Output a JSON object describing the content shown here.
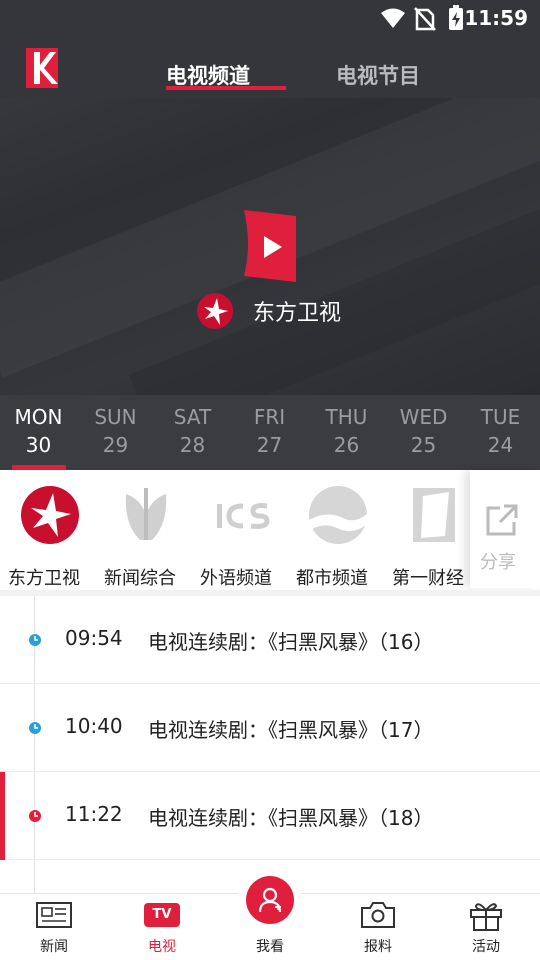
{
  "status_bar": {
    "time": "11:59"
  },
  "header": {
    "tabs": [
      {
        "label": "电视频道",
        "active": true
      },
      {
        "label": "电视节目",
        "active": false
      }
    ]
  },
  "player": {
    "channel_name": "东方卫视"
  },
  "dates": [
    {
      "dow": "MON",
      "num": "30",
      "active": true
    },
    {
      "dow": "SUN",
      "num": "29",
      "active": false
    },
    {
      "dow": "SAT",
      "num": "28",
      "active": false
    },
    {
      "dow": "FRI",
      "num": "27",
      "active": false
    },
    {
      "dow": "THU",
      "num": "26",
      "active": false
    },
    {
      "dow": "WED",
      "num": "25",
      "active": false
    },
    {
      "dow": "TUE",
      "num": "24",
      "active": false
    }
  ],
  "channels": [
    {
      "label": "东方卫视",
      "icon": "dragon-tv-icon"
    },
    {
      "label": "新闻综合",
      "icon": "news-channel-icon"
    },
    {
      "label": "外语频道",
      "icon": "ics-icon"
    },
    {
      "label": "都市频道",
      "icon": "city-channel-icon"
    },
    {
      "label": "第一财经",
      "icon": "finance-channel-icon"
    }
  ],
  "share": {
    "label": "分享",
    "icon": "share-icon"
  },
  "schedule": [
    {
      "time": "09:54",
      "title": "电视连续剧：《扫黑风暴》（16）",
      "live": false
    },
    {
      "time": "10:40",
      "title": "电视连续剧：《扫黑风暴》（17）",
      "live": false
    },
    {
      "time": "11:22",
      "title": "电视连续剧：《扫黑风暴》（18）",
      "live": true
    }
  ],
  "bottom_nav": [
    {
      "label": "新闻",
      "icon": "newspaper-icon"
    },
    {
      "label": "电视",
      "icon": "tv-icon",
      "badge": "TV",
      "active": true
    },
    {
      "label": "我看",
      "icon": "user-icon"
    },
    {
      "label": "报料",
      "icon": "camera-icon"
    },
    {
      "label": "活动",
      "icon": "gift-icon"
    }
  ],
  "colors": {
    "accent": "#e01f3d",
    "header_bg": "#34363b",
    "datebar_bg": "#3a3c40",
    "clock_dot": "#2a9fd8"
  }
}
